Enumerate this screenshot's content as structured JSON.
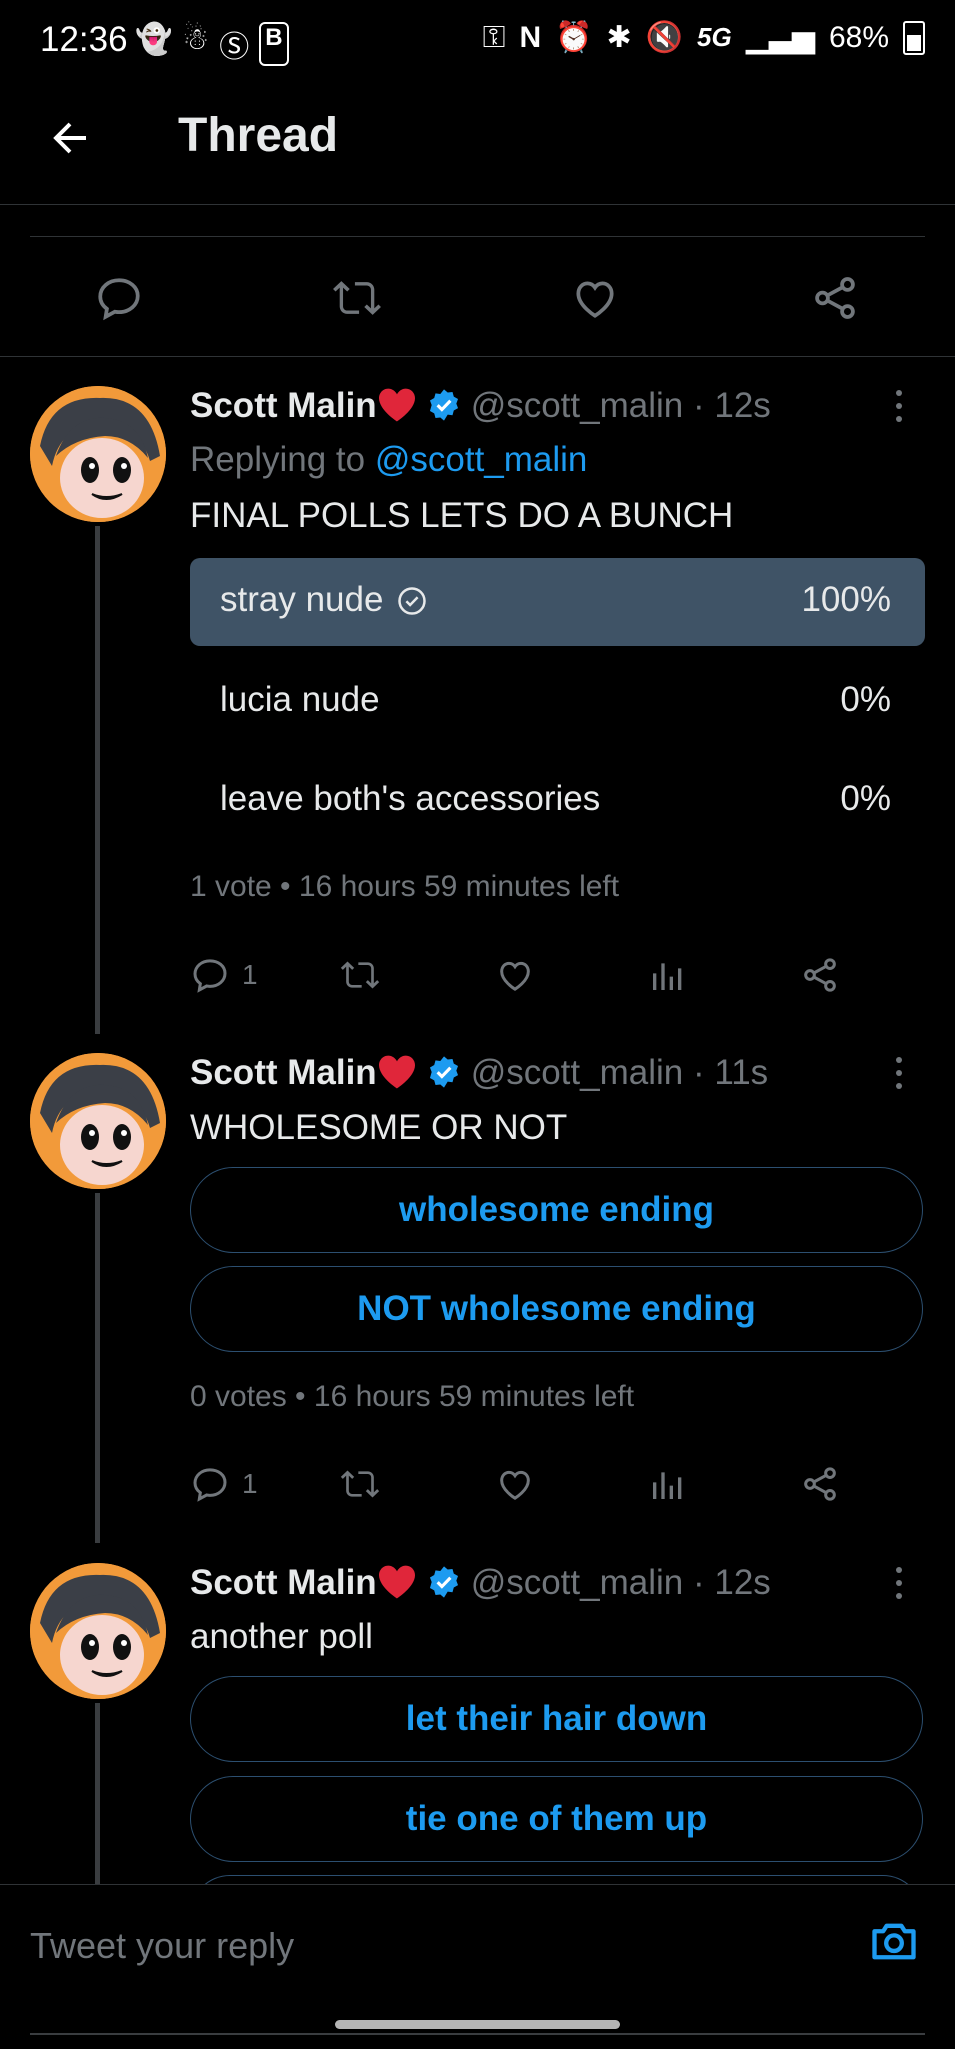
{
  "status_bar": {
    "time": "12:36",
    "network": "5G",
    "battery": "68%"
  },
  "header": {
    "title": "Thread"
  },
  "tweets": [
    {
      "name": "Scott Malin",
      "handle": "@scott_malin",
      "age": "· 12s",
      "replying_label": "Replying to",
      "replying_to": "@scott_malin",
      "text": "FINAL POLLS LETS DO A BUNCH",
      "poll_results": [
        {
          "label": "stray nude",
          "percent": "100%",
          "winner": true
        },
        {
          "label": "lucia nude",
          "percent": "0%",
          "winner": false
        },
        {
          "label": "leave both's accessories",
          "percent": "0%",
          "winner": false
        }
      ],
      "poll_meta": "1 vote • 16 hours 59 minutes left",
      "reply_count": "1"
    },
    {
      "name": "Scott Malin",
      "handle": "@scott_malin",
      "age": "· 11s",
      "text": "WHOLESOME OR NOT",
      "poll_options": [
        "wholesome ending",
        "NOT wholesome ending"
      ],
      "poll_meta": "0 votes • 16 hours 59 minutes left",
      "reply_count": "1"
    },
    {
      "name": "Scott Malin",
      "handle": "@scott_malin",
      "age": "· 12s",
      "text": "another poll",
      "poll_options": [
        "let their hair down",
        "tie one of them up"
      ]
    }
  ],
  "reply_bar": {
    "placeholder": "Tweet your reply"
  },
  "colors": {
    "accent": "#1d9bf0",
    "winner_bar": "#3f5366",
    "verified": "#1d9bf0",
    "heart": "#e0263a"
  },
  "icons": [
    "back-arrow-icon",
    "reply-icon",
    "retweet-icon",
    "like-icon",
    "share-icon",
    "views-icon",
    "verified-badge-icon",
    "more-icon",
    "camera-icon",
    "check-icon"
  ]
}
